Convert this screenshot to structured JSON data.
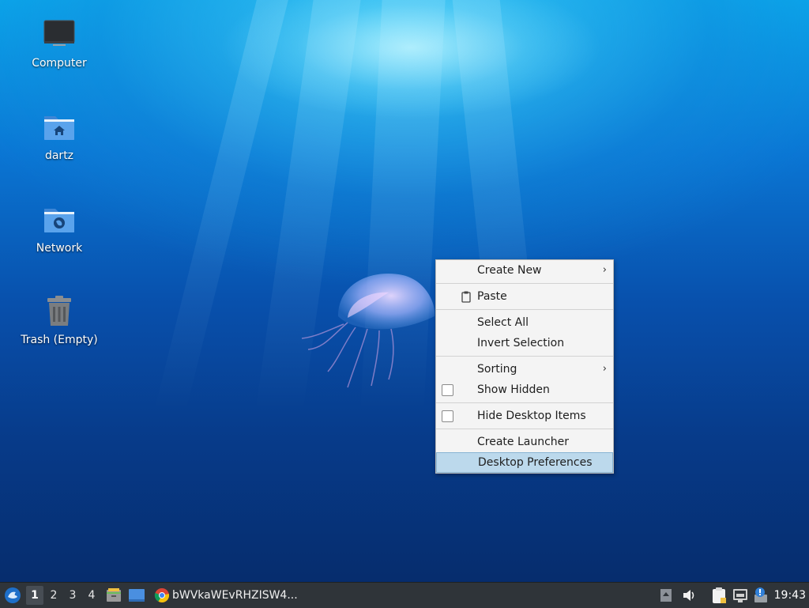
{
  "desktop": {
    "icons": [
      {
        "label": "Computer",
        "icon": "computer-icon"
      },
      {
        "label": "dartz",
        "icon": "home-folder-icon"
      },
      {
        "label": "Network",
        "icon": "network-folder-icon"
      },
      {
        "label": "Trash (Empty)",
        "icon": "trash-icon"
      }
    ]
  },
  "context_menu": {
    "create_new": "Create New",
    "paste": "Paste",
    "select_all": "Select All",
    "invert_selection": "Invert Selection",
    "sorting": "Sorting",
    "show_hidden": "Show Hidden",
    "show_hidden_checked": false,
    "hide_desktop_items": "Hide Desktop Items",
    "hide_desktop_items_checked": false,
    "create_launcher": "Create Launcher",
    "desktop_preferences": "Desktop Preferences",
    "highlighted_item": "Desktop Preferences",
    "submenu_arrow": "›"
  },
  "taskbar": {
    "workspaces": [
      "1",
      "2",
      "3",
      "4"
    ],
    "active_workspace": "1",
    "task_title": "bWVkaWEvRHZISW4...",
    "clock": "19:43",
    "tray_icons": [
      "scroll-up-icon",
      "volume-icon",
      "clipboard-icon",
      "network-icon",
      "update-notifier-icon"
    ]
  },
  "colors": {
    "menu_highlight": "#bcd9ec",
    "taskbar_bg": "#2f3439"
  }
}
